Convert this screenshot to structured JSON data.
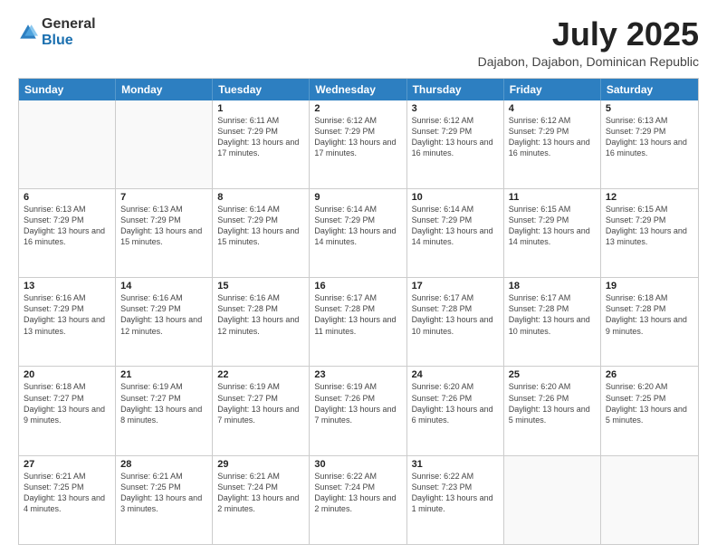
{
  "header": {
    "logo_general": "General",
    "logo_blue": "Blue",
    "month_year": "July 2025",
    "location": "Dajabon, Dajabon, Dominican Republic"
  },
  "calendar": {
    "days_of_week": [
      "Sunday",
      "Monday",
      "Tuesday",
      "Wednesday",
      "Thursday",
      "Friday",
      "Saturday"
    ],
    "weeks": [
      [
        {
          "day": "",
          "empty": true
        },
        {
          "day": "",
          "empty": true
        },
        {
          "day": "1",
          "sunrise": "6:11 AM",
          "sunset": "7:29 PM",
          "daylight": "13 hours and 17 minutes."
        },
        {
          "day": "2",
          "sunrise": "6:12 AM",
          "sunset": "7:29 PM",
          "daylight": "13 hours and 17 minutes."
        },
        {
          "day": "3",
          "sunrise": "6:12 AM",
          "sunset": "7:29 PM",
          "daylight": "13 hours and 16 minutes."
        },
        {
          "day": "4",
          "sunrise": "6:12 AM",
          "sunset": "7:29 PM",
          "daylight": "13 hours and 16 minutes."
        },
        {
          "day": "5",
          "sunrise": "6:13 AM",
          "sunset": "7:29 PM",
          "daylight": "13 hours and 16 minutes."
        }
      ],
      [
        {
          "day": "6",
          "sunrise": "6:13 AM",
          "sunset": "7:29 PM",
          "daylight": "13 hours and 16 minutes."
        },
        {
          "day": "7",
          "sunrise": "6:13 AM",
          "sunset": "7:29 PM",
          "daylight": "13 hours and 15 minutes."
        },
        {
          "day": "8",
          "sunrise": "6:14 AM",
          "sunset": "7:29 PM",
          "daylight": "13 hours and 15 minutes."
        },
        {
          "day": "9",
          "sunrise": "6:14 AM",
          "sunset": "7:29 PM",
          "daylight": "13 hours and 14 minutes."
        },
        {
          "day": "10",
          "sunrise": "6:14 AM",
          "sunset": "7:29 PM",
          "daylight": "13 hours and 14 minutes."
        },
        {
          "day": "11",
          "sunrise": "6:15 AM",
          "sunset": "7:29 PM",
          "daylight": "13 hours and 14 minutes."
        },
        {
          "day": "12",
          "sunrise": "6:15 AM",
          "sunset": "7:29 PM",
          "daylight": "13 hours and 13 minutes."
        }
      ],
      [
        {
          "day": "13",
          "sunrise": "6:16 AM",
          "sunset": "7:29 PM",
          "daylight": "13 hours and 13 minutes."
        },
        {
          "day": "14",
          "sunrise": "6:16 AM",
          "sunset": "7:29 PM",
          "daylight": "13 hours and 12 minutes."
        },
        {
          "day": "15",
          "sunrise": "6:16 AM",
          "sunset": "7:28 PM",
          "daylight": "13 hours and 12 minutes."
        },
        {
          "day": "16",
          "sunrise": "6:17 AM",
          "sunset": "7:28 PM",
          "daylight": "13 hours and 11 minutes."
        },
        {
          "day": "17",
          "sunrise": "6:17 AM",
          "sunset": "7:28 PM",
          "daylight": "13 hours and 10 minutes."
        },
        {
          "day": "18",
          "sunrise": "6:17 AM",
          "sunset": "7:28 PM",
          "daylight": "13 hours and 10 minutes."
        },
        {
          "day": "19",
          "sunrise": "6:18 AM",
          "sunset": "7:28 PM",
          "daylight": "13 hours and 9 minutes."
        }
      ],
      [
        {
          "day": "20",
          "sunrise": "6:18 AM",
          "sunset": "7:27 PM",
          "daylight": "13 hours and 9 minutes."
        },
        {
          "day": "21",
          "sunrise": "6:19 AM",
          "sunset": "7:27 PM",
          "daylight": "13 hours and 8 minutes."
        },
        {
          "day": "22",
          "sunrise": "6:19 AM",
          "sunset": "7:27 PM",
          "daylight": "13 hours and 7 minutes."
        },
        {
          "day": "23",
          "sunrise": "6:19 AM",
          "sunset": "7:26 PM",
          "daylight": "13 hours and 7 minutes."
        },
        {
          "day": "24",
          "sunrise": "6:20 AM",
          "sunset": "7:26 PM",
          "daylight": "13 hours and 6 minutes."
        },
        {
          "day": "25",
          "sunrise": "6:20 AM",
          "sunset": "7:26 PM",
          "daylight": "13 hours and 5 minutes."
        },
        {
          "day": "26",
          "sunrise": "6:20 AM",
          "sunset": "7:25 PM",
          "daylight": "13 hours and 5 minutes."
        }
      ],
      [
        {
          "day": "27",
          "sunrise": "6:21 AM",
          "sunset": "7:25 PM",
          "daylight": "13 hours and 4 minutes."
        },
        {
          "day": "28",
          "sunrise": "6:21 AM",
          "sunset": "7:25 PM",
          "daylight": "13 hours and 3 minutes."
        },
        {
          "day": "29",
          "sunrise": "6:21 AM",
          "sunset": "7:24 PM",
          "daylight": "13 hours and 2 minutes."
        },
        {
          "day": "30",
          "sunrise": "6:22 AM",
          "sunset": "7:24 PM",
          "daylight": "13 hours and 2 minutes."
        },
        {
          "day": "31",
          "sunrise": "6:22 AM",
          "sunset": "7:23 PM",
          "daylight": "13 hours and 1 minute."
        },
        {
          "day": "",
          "empty": true
        },
        {
          "day": "",
          "empty": true
        }
      ]
    ]
  }
}
